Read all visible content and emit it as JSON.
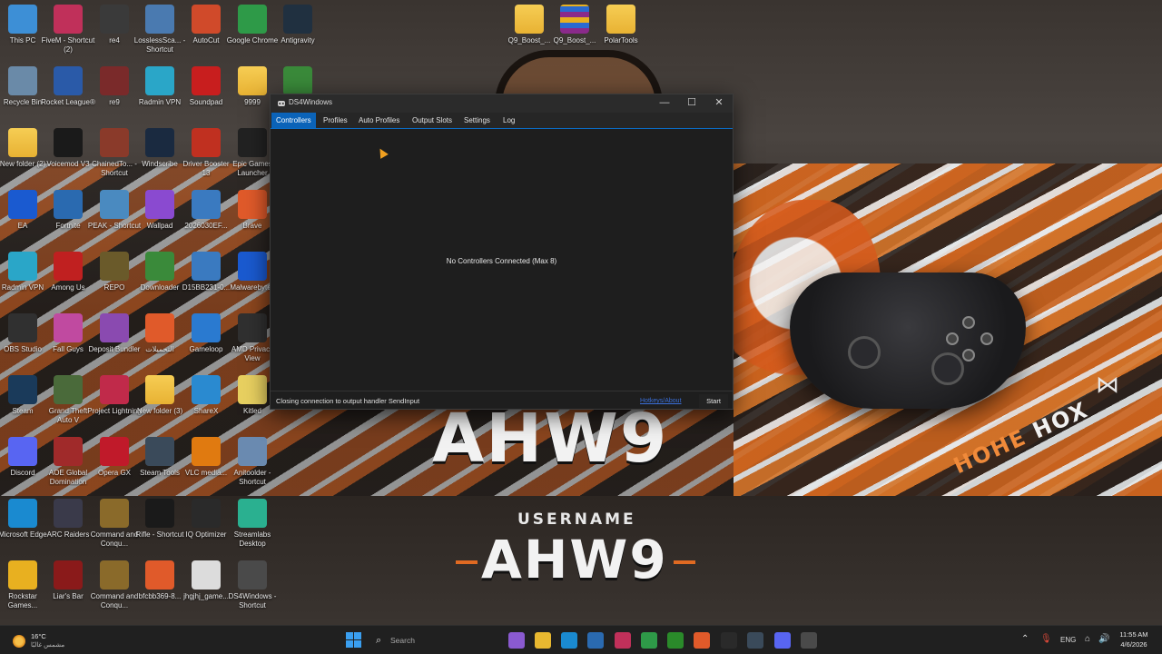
{
  "wallpaper": {
    "big_text_top": "AHW9",
    "username_label": "USERNAME",
    "big_text_bottom": "AHW9",
    "hox_left": "HOHE",
    "hox_right": "HOX",
    "colors": {
      "orange": "#e06a22",
      "white": "#f2f2f2"
    }
  },
  "desktop_icons": [
    {
      "label": "This PC",
      "icon": "monitor-icon",
      "color": "#3d8fd6"
    },
    {
      "label": "FiveM - Shortcut (2)",
      "icon": "fivem-icon",
      "color": "#c0305a"
    },
    {
      "label": "re4",
      "icon": "re4-icon",
      "color": "#3a3a3a"
    },
    {
      "label": "LosslessSca... - Shortcut",
      "icon": "lossless-icon",
      "color": "#4a7ab0"
    },
    {
      "label": "AutoCut",
      "icon": "autocut-icon",
      "color": "#d04a2a"
    },
    {
      "label": "Google Chrome",
      "icon": "chrome-icon",
      "color": "#2e9a48"
    },
    {
      "label": "Antigravity",
      "icon": "antigravity-icon",
      "color": "#203040"
    },
    {
      "label": "Recycle Bin",
      "icon": "recycle-bin-icon",
      "color": "#6a8aa8"
    },
    {
      "label": "Rocket League®",
      "icon": "rocket-league-icon",
      "color": "#2a5aa8"
    },
    {
      "label": "re9",
      "icon": "re9-icon",
      "color": "#7a2a2a"
    },
    {
      "label": "Radmin VPN",
      "icon": "radmin-icon",
      "color": "#2aa6c8"
    },
    {
      "label": "Soundpad",
      "icon": "soundpad-icon",
      "color": "#c81e1e"
    },
    {
      "label": "9999",
      "icon": "folder-icon",
      "color": "#f0c040"
    },
    {
      "label": "",
      "icon": "app-icon",
      "color": "#3a8a3a"
    },
    {
      "label": "New folder (2)",
      "icon": "folder-icon",
      "color": "#f0c040"
    },
    {
      "label": "Voicemod V3",
      "icon": "voicemod-icon",
      "color": "#1a1a1a"
    },
    {
      "label": "ChainedTo... - Shortcut",
      "icon": "chained-icon",
      "color": "#8a3a2a"
    },
    {
      "label": "Windscribe",
      "icon": "windscribe-icon",
      "color": "#1a2a40"
    },
    {
      "label": "Driver Booster 13",
      "icon": "driver-booster-icon",
      "color": "#c03020"
    },
    {
      "label": "Epic Games Launcher",
      "icon": "epic-icon",
      "color": "#222222"
    },
    {
      "label": "EA",
      "icon": "ea-icon",
      "color": "#1a5ad0"
    },
    {
      "label": "Fortnite",
      "icon": "fortnite-icon",
      "color": "#2a6ab0"
    },
    {
      "label": "PEAK - Shortcut",
      "icon": "peak-icon",
      "color": "#4a8ac0"
    },
    {
      "label": "Wallpad",
      "icon": "wallpad-icon",
      "color": "#8a4ad0"
    },
    {
      "label": "2026030EF...",
      "icon": "image-icon",
      "color": "#3a7ac0"
    },
    {
      "label": "Brave",
      "icon": "brave-icon",
      "color": "#e05a2a"
    },
    {
      "label": "Radmin VPN",
      "icon": "radmin-icon",
      "color": "#2aa6c8"
    },
    {
      "label": "Among Us",
      "icon": "among-us-icon",
      "color": "#c02020"
    },
    {
      "label": "REPO",
      "icon": "repo-icon",
      "color": "#6a5a2a"
    },
    {
      "label": "Downloader",
      "icon": "downloader-icon",
      "color": "#3a8a3a"
    },
    {
      "label": "D15BB231-0...",
      "icon": "image-icon",
      "color": "#3a7ac0"
    },
    {
      "label": "Malwarebytes",
      "icon": "malwarebytes-icon",
      "color": "#1a5ad0"
    },
    {
      "label": "OBS Studio",
      "icon": "obs-icon",
      "color": "#303030"
    },
    {
      "label": "Fall Guys",
      "icon": "fall-guys-icon",
      "color": "#c04aa0"
    },
    {
      "label": "Deposit Bundler",
      "icon": "deposit-icon",
      "color": "#8a4ab0"
    },
    {
      "label": "التحميلات",
      "icon": "downloads-icon",
      "color": "#e05a2a"
    },
    {
      "label": "Gameloop",
      "icon": "gameloop-icon",
      "color": "#2a7ad0"
    },
    {
      "label": "AMD Privacy View",
      "icon": "amd-icon",
      "color": "#303030"
    },
    {
      "label": "Steam",
      "icon": "steam-icon",
      "color": "#1a3a5a"
    },
    {
      "label": "Grand Theft Auto V",
      "icon": "gta-icon",
      "color": "#4a6a3a"
    },
    {
      "label": "Project Lightning",
      "icon": "lightning-icon",
      "color": "#c02a4a"
    },
    {
      "label": "New folder (3)",
      "icon": "folder-icon",
      "color": "#f0c040"
    },
    {
      "label": "ShareX",
      "icon": "sharex-icon",
      "color": "#2a8ad0"
    },
    {
      "label": "Kitled",
      "icon": "file-icon",
      "color": "#e8d060"
    },
    {
      "label": "Discord",
      "icon": "discord-icon",
      "color": "#5865f2"
    },
    {
      "label": "AOE Global Domination",
      "icon": "aoe-icon",
      "color": "#a02a2a"
    },
    {
      "label": "Opera GX",
      "icon": "opera-icon",
      "color": "#c01a2a"
    },
    {
      "label": "Steam Tools",
      "icon": "steam-icon",
      "color": "#3a4a5a"
    },
    {
      "label": "VLC media...",
      "icon": "vlc-icon",
      "color": "#e07a10"
    },
    {
      "label": "Anitoolder - Shortcut",
      "icon": "anitoolder-icon",
      "color": "#6a8ab0"
    },
    {
      "label": "Microsoft Edge",
      "icon": "edge-icon",
      "color": "#1a8ad0"
    },
    {
      "label": "ARC Raiders",
      "icon": "arc-raiders-icon",
      "color": "#3a3a4a"
    },
    {
      "label": "Command and Conqu...",
      "icon": "cnc-icon",
      "color": "#8a6a2a"
    },
    {
      "label": "Rifle - Shortcut",
      "icon": "unreal-icon",
      "color": "#1a1a1a"
    },
    {
      "label": "IQ Optimizer",
      "icon": "iq-icon",
      "color": "#2a2a2a"
    },
    {
      "label": "Streamlabs Desktop",
      "icon": "streamlabs-icon",
      "color": "#2ab090"
    },
    {
      "label": "Rockstar Games...",
      "icon": "rockstar-icon",
      "color": "#e8b020"
    },
    {
      "label": "Liar's Bar",
      "icon": "liars-bar-icon",
      "color": "#8a1a1a"
    },
    {
      "label": "Command and Conqu...",
      "icon": "cnc-icon",
      "color": "#8a6a2a"
    },
    {
      "label": "bfcbb369-8...",
      "icon": "brave-icon",
      "color": "#e05a2a"
    },
    {
      "label": "jhgjhj_game...",
      "icon": "file-icon",
      "color": "#dcdcdc"
    },
    {
      "label": "DS4Windows - Shortcut",
      "icon": "ds4windows-icon",
      "color": "#4a4a4a"
    }
  ],
  "top_files": [
    {
      "label": "Q9_Boost_...",
      "icon": "folder-icon"
    },
    {
      "label": "Q9_Boost_...",
      "icon": "winrar-icon"
    },
    {
      "label": "PolarTools",
      "icon": "folder-icon"
    }
  ],
  "window": {
    "title": "DS4Windows",
    "minimize": "—",
    "maximize": "☐",
    "close": "✕",
    "tabs": [
      {
        "label": "Controllers"
      },
      {
        "label": "Profiles"
      },
      {
        "label": "Auto Profiles"
      },
      {
        "label": "Output Slots"
      },
      {
        "label": "Settings"
      },
      {
        "label": "Log"
      }
    ],
    "active_tab": "Controllers",
    "empty_message": "No Controllers Connected (Max 8)",
    "status_text": "Closing connection to output handler SendInput",
    "hotkeys_link": "Hotkeys/About",
    "start_button": "Start",
    "accent_color": "#0b63b8"
  },
  "taskbar": {
    "weather_temp": "16°C",
    "weather_condition": "مشمس غالبًا",
    "search_placeholder": "Search",
    "apps": [
      {
        "icon": "copilot-icon",
        "color": "#8a5ad0"
      },
      {
        "icon": "file-explorer-icon",
        "color": "#e8b830"
      },
      {
        "icon": "edge-icon",
        "color": "#1a8ad0"
      },
      {
        "icon": "store-icon",
        "color": "#2a6ab0"
      },
      {
        "icon": "fivem-icon",
        "color": "#c0305a"
      },
      {
        "icon": "chrome-icon",
        "color": "#2e9a48"
      },
      {
        "icon": "xbox-icon",
        "color": "#2a8a2a"
      },
      {
        "icon": "brave-icon",
        "color": "#e05a2a"
      },
      {
        "icon": "terminal-icon",
        "color": "#2a2a2a"
      },
      {
        "icon": "steam-icon",
        "color": "#3a4a5a"
      },
      {
        "icon": "discord-icon",
        "color": "#5865f2"
      },
      {
        "icon": "ds4windows-icon",
        "color": "#4a4a4a"
      }
    ],
    "tray_language": "ENG",
    "time": "11:55 AM",
    "date": "4/6/2026"
  }
}
